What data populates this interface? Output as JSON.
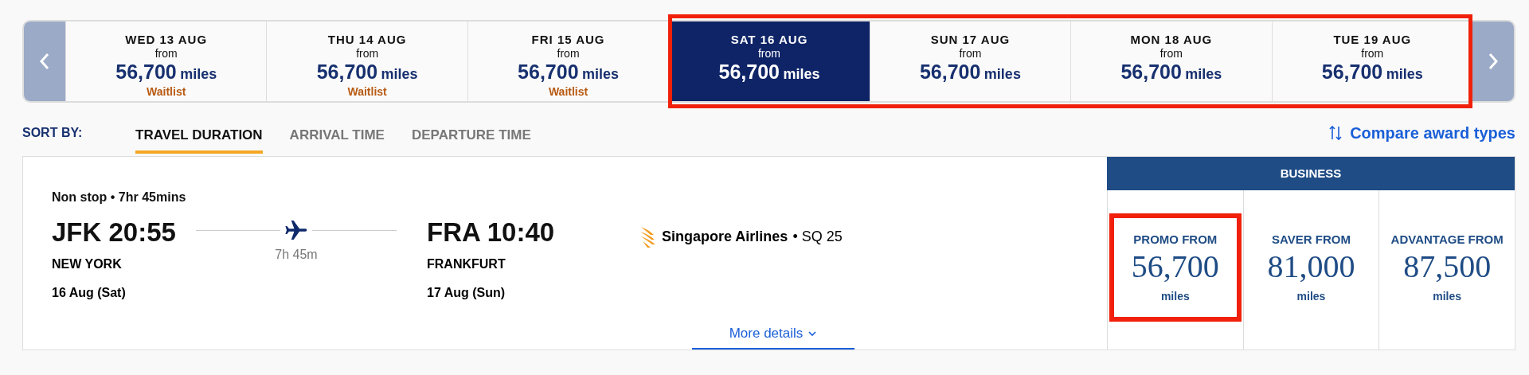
{
  "dates": [
    {
      "day": "WED 13 AUG",
      "from": "from",
      "amount": "56,700",
      "unit": "miles",
      "status": "Waitlist",
      "selected": false,
      "highlighted": false
    },
    {
      "day": "THU 14 AUG",
      "from": "from",
      "amount": "56,700",
      "unit": "miles",
      "status": "Waitlist",
      "selected": false,
      "highlighted": false
    },
    {
      "day": "FRI 15 AUG",
      "from": "from",
      "amount": "56,700",
      "unit": "miles",
      "status": "Waitlist",
      "selected": false,
      "highlighted": false
    },
    {
      "day": "SAT 16 AUG",
      "from": "from",
      "amount": "56,700",
      "unit": "miles",
      "selected": true,
      "highlighted": true
    },
    {
      "day": "SUN 17 AUG",
      "from": "from",
      "amount": "56,700",
      "unit": "miles",
      "selected": false,
      "highlighted": true
    },
    {
      "day": "MON 18 AUG",
      "from": "from",
      "amount": "56,700",
      "unit": "miles",
      "selected": false,
      "highlighted": true
    },
    {
      "day": "TUE 19 AUG",
      "from": "from",
      "amount": "56,700",
      "unit": "miles",
      "selected": false,
      "highlighted": true
    }
  ],
  "sort": {
    "label": "SORT BY:",
    "options": [
      {
        "label": "TRAVEL DURATION",
        "selected": true
      },
      {
        "label": "ARRIVAL TIME",
        "selected": false
      },
      {
        "label": "DEPARTURE TIME",
        "selected": false
      }
    ],
    "compare_link": "Compare award types"
  },
  "flight": {
    "summary": "Non stop • 7hr 45mins",
    "origin": {
      "code_time": "JFK 20:55",
      "city": "NEW YORK",
      "date": "16 Aug (Sat)"
    },
    "duration": "7h 45m",
    "destination": {
      "code_time": "FRA 10:40",
      "city": "FRANKFURT",
      "date": "17 Aug (Sun)"
    },
    "airline": "Singapore Airlines",
    "flight_number": "• SQ 25",
    "more_details": "More details"
  },
  "cabin": "BUSINESS",
  "fares": [
    {
      "label": "PROMO FROM",
      "amount": "56,700",
      "unit": "miles",
      "highlighted": true
    },
    {
      "label": "SAVER FROM",
      "amount": "81,000",
      "unit": "miles",
      "highlighted": false
    },
    {
      "label": "ADVANTAGE FROM",
      "amount": "87,500",
      "unit": "miles",
      "highlighted": false
    }
  ]
}
